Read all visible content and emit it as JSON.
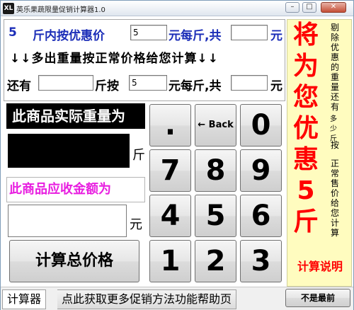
{
  "window": {
    "title": "英乐果蔬限量促销计算器1.0",
    "icon_text": "XL",
    "buttons": {
      "minimize": "–",
      "maximize": "□",
      "close": "✕"
    }
  },
  "promo_row": {
    "limit_qty": "5",
    "text_a": "斤内按优惠价",
    "price_value": "5",
    "text_b": "元每斤,共",
    "total_value": "",
    "text_c": "元"
  },
  "excess_row": {
    "text": "↓↓多出重量按正常价格给您计算↓↓"
  },
  "remain_row": {
    "text_a": "还有",
    "remain_value": "",
    "text_b": "斤按",
    "price_value": "5",
    "text_c": "元每斤,共",
    "total_value": "",
    "text_d": "元"
  },
  "weight": {
    "label": "此商品实际重量为",
    "unit": "斤"
  },
  "amount": {
    "label": "此商品应收金额为",
    "unit": "元"
  },
  "calc_button": "计算总价格",
  "keypad": {
    "dot": ".",
    "back": "← Back",
    "k0": "0",
    "k1": "1",
    "k2": "2",
    "k3": "3",
    "k4": "4",
    "k5": "5",
    "k6": "6",
    "k7": "7",
    "k8": "8",
    "k9": "9"
  },
  "right_panel": {
    "big_chars": [
      "将",
      "为",
      "您",
      "优",
      "惠",
      "5",
      "斤"
    ],
    "vertical_1": "剔除优惠的重量还有",
    "vertical_2": "多少斤",
    "vertical_3": "按",
    "vertical_4": "正常售价给您计算",
    "explain": "计算说明"
  },
  "tabs": {
    "calculator": "计算器",
    "help": "点此获取更多促销方法功能帮助页"
  },
  "not_topmost_button": "不是最前",
  "colors": {
    "blue_text": "#1c2eb8",
    "red_text": "#ff0000",
    "magenta_text": "#e81ee0",
    "panel_yellow": "#fffcbf"
  }
}
